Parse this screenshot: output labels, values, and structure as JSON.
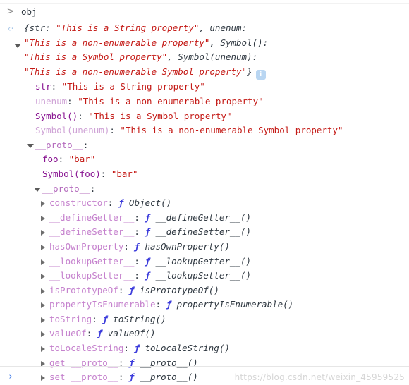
{
  "console": {
    "prompt_glyph": ">",
    "response_glyph": "‹·",
    "bottom_prompt_glyph": "›",
    "input_command": "obj",
    "info_badge_glyph": "i",
    "watermark": "https://blog.csdn.net/weixin_45959525"
  },
  "preview": {
    "lines": [
      [
        {
          "t": "{str: ",
          "c": "plain"
        },
        {
          "t": "\"This is a String property\"",
          "c": "string"
        },
        {
          "t": ", unenum:",
          "c": "plain"
        }
      ],
      [
        {
          "t": "\"This is a non-enumerable property\"",
          "c": "string"
        },
        {
          "t": ", Symbol():",
          "c": "plain"
        }
      ],
      [
        {
          "t": "\"This is a Symbol property\"",
          "c": "string"
        },
        {
          "t": ", Symbol(unenum):",
          "c": "plain"
        }
      ],
      [
        {
          "t": "\"This is a non-enumerable Symbol property\"",
          "c": "string"
        },
        {
          "t": "}",
          "c": "plain"
        }
      ]
    ]
  },
  "tree": {
    "nodes": [
      {
        "indent": 0,
        "arrow": "none",
        "key": "str",
        "key_style": "enum",
        "sep": ": ",
        "value": "\"This is a String property\"",
        "value_style": "string"
      },
      {
        "indent": 0,
        "arrow": "none",
        "key": "unenum",
        "key_style": "nonenum",
        "sep": ": ",
        "value": "\"This is a non-enumerable property\"",
        "value_style": "string"
      },
      {
        "indent": 0,
        "arrow": "none",
        "key": "Symbol()",
        "key_style": "enum",
        "sep": ": ",
        "value": "\"This is a Symbol property\"",
        "value_style": "string"
      },
      {
        "indent": 0,
        "arrow": "none",
        "key": "Symbol(unenum)",
        "key_style": "nonenum",
        "sep": ": ",
        "value": "\"This is a non-enumerable Symbol property\"",
        "value_style": "string"
      },
      {
        "indent": 0,
        "arrow": "open",
        "key": "__proto__",
        "key_style": "proto",
        "sep": ":",
        "value": "",
        "value_style": "none"
      },
      {
        "indent": 1,
        "arrow": "none",
        "key": "foo",
        "key_style": "enum",
        "sep": ": ",
        "value": "\"bar\"",
        "value_style": "string"
      },
      {
        "indent": 1,
        "arrow": "none",
        "key": "Symbol(foo)",
        "key_style": "enum",
        "sep": ": ",
        "value": "\"bar\"",
        "value_style": "string"
      },
      {
        "indent": 1,
        "arrow": "open",
        "key": "__proto__",
        "key_style": "proto",
        "sep": ":",
        "value": "",
        "value_style": "none"
      },
      {
        "indent": 2,
        "arrow": "closed",
        "key": "constructor",
        "key_style": "method",
        "sep": ": ",
        "value": "Object()",
        "value_style": "function"
      },
      {
        "indent": 2,
        "arrow": "closed",
        "key": "__defineGetter__",
        "key_style": "method",
        "sep": ": ",
        "value": "__defineGetter__()",
        "value_style": "function"
      },
      {
        "indent": 2,
        "arrow": "closed",
        "key": "__defineSetter__",
        "key_style": "method",
        "sep": ": ",
        "value": "__defineSetter__()",
        "value_style": "function"
      },
      {
        "indent": 2,
        "arrow": "closed",
        "key": "hasOwnProperty",
        "key_style": "method",
        "sep": ": ",
        "value": "hasOwnProperty()",
        "value_style": "function"
      },
      {
        "indent": 2,
        "arrow": "closed",
        "key": "__lookupGetter__",
        "key_style": "method",
        "sep": ": ",
        "value": "__lookupGetter__()",
        "value_style": "function"
      },
      {
        "indent": 2,
        "arrow": "closed",
        "key": "__lookupSetter__",
        "key_style": "method",
        "sep": ": ",
        "value": "__lookupSetter__()",
        "value_style": "function"
      },
      {
        "indent": 2,
        "arrow": "closed",
        "key": "isPrototypeOf",
        "key_style": "method",
        "sep": ": ",
        "value": "isPrototypeOf()",
        "value_style": "function"
      },
      {
        "indent": 2,
        "arrow": "closed",
        "key": "propertyIsEnumerable",
        "key_style": "method",
        "sep": ": ",
        "value": "propertyIsEnumerable()",
        "value_style": "function"
      },
      {
        "indent": 2,
        "arrow": "closed",
        "key": "toString",
        "key_style": "method",
        "sep": ": ",
        "value": "toString()",
        "value_style": "function"
      },
      {
        "indent": 2,
        "arrow": "closed",
        "key": "valueOf",
        "key_style": "method",
        "sep": ": ",
        "value": "valueOf()",
        "value_style": "function"
      },
      {
        "indent": 2,
        "arrow": "closed",
        "key": "toLocaleString",
        "key_style": "method",
        "sep": ": ",
        "value": "toLocaleString()",
        "value_style": "function"
      },
      {
        "indent": 2,
        "arrow": "closed",
        "key": "get __proto__",
        "key_style": "accessor",
        "sep": ": ",
        "value": "__proto__()",
        "value_style": "function"
      },
      {
        "indent": 2,
        "arrow": "closed",
        "key": "set __proto__",
        "key_style": "accessor",
        "sep": ": ",
        "value": "__proto__()",
        "value_style": "function"
      }
    ]
  },
  "colors": {
    "string": "#c41a16",
    "key_enumerable": "#881391",
    "key_non_enumerable": "#cfa3d6",
    "proto": "#b46bbd",
    "function_mark": "#3b3bdb",
    "info_badge": "#b9d6f2",
    "prompt_blue": "#3b78e7"
  }
}
